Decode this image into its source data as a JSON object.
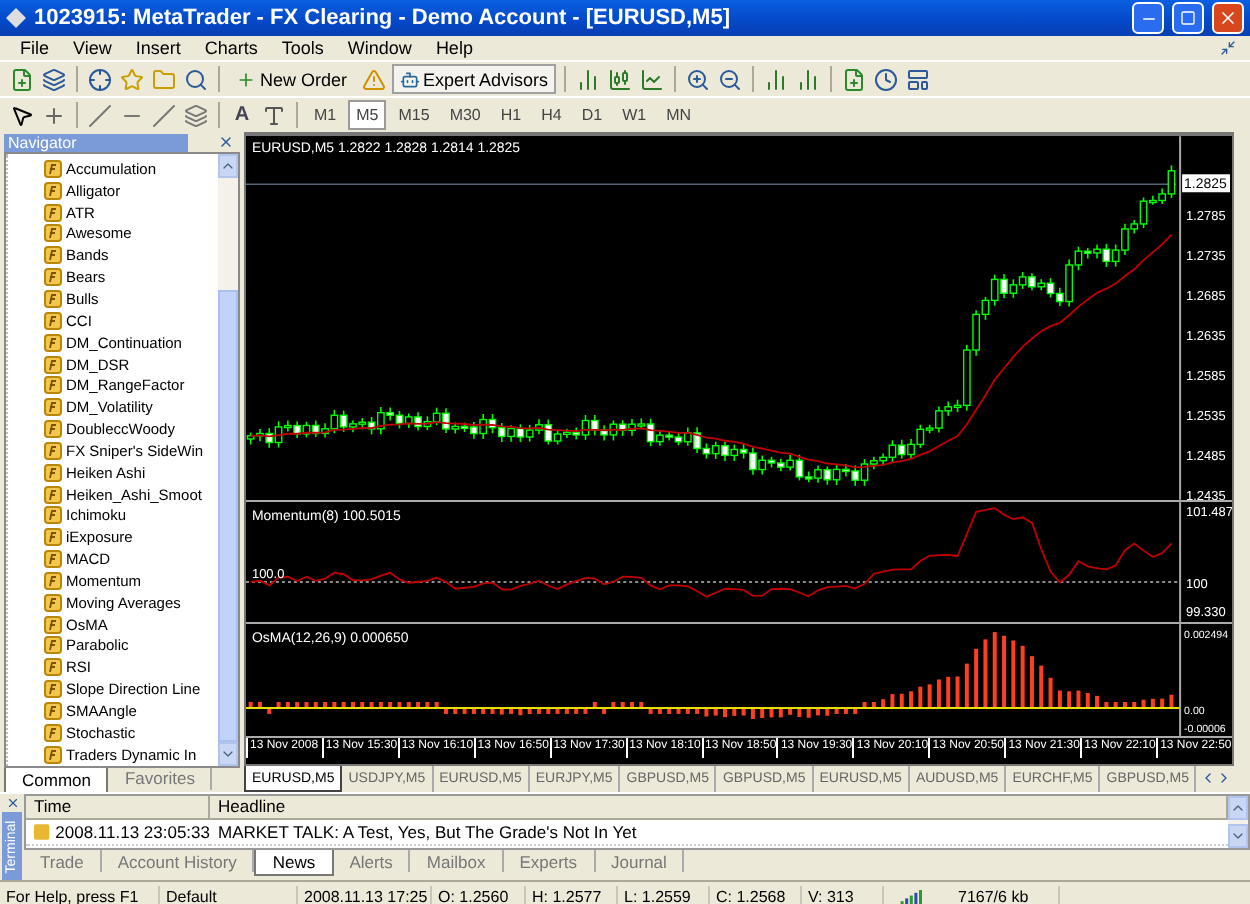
{
  "window": {
    "title": "1023915: MetaTrader - FX Clearing - Demo Account - [EURUSD,M5]"
  },
  "menu": [
    "File",
    "View",
    "Insert",
    "Charts",
    "Tools",
    "Window",
    "Help"
  ],
  "toolbar": {
    "new_order": "New Order",
    "expert_advisors": {
      "label": "Expert Advisors",
      "pressed": true
    },
    "text_tool": "A"
  },
  "timeframes": [
    {
      "label": "M1",
      "selected": false
    },
    {
      "label": "M5",
      "selected": true
    },
    {
      "label": "M15",
      "selected": false
    },
    {
      "label": "M30",
      "selected": false
    },
    {
      "label": "H1",
      "selected": false
    },
    {
      "label": "H4",
      "selected": false
    },
    {
      "label": "D1",
      "selected": false
    },
    {
      "label": "W1",
      "selected": false
    },
    {
      "label": "MN",
      "selected": false
    }
  ],
  "navigator": {
    "title": "Navigator",
    "items": [
      "Accumulation",
      "Alligator",
      "ATR",
      "Awesome",
      "Bands",
      "Bears",
      "Bulls",
      "CCI",
      "DM_Continuation",
      "DM_DSR",
      "DM_RangeFactor",
      "DM_Volatility",
      "DoubleccWoody",
      "FX Sniper's SideWin",
      "Heiken Ashi",
      "Heiken_Ashi_Smoot",
      "Ichimoku",
      "iExposure",
      "MACD",
      "Momentum",
      "Moving Averages",
      "OsMA",
      "Parabolic",
      "RSI",
      "Slope Direction Line",
      "SMAAngle",
      "Stochastic",
      "Traders Dynamic In"
    ],
    "tabs": [
      {
        "label": "Common",
        "selected": true
      },
      {
        "label": "Favorites",
        "selected": false
      }
    ]
  },
  "chart": {
    "header": "EURUSD,M5  1.2822 1.2828 1.2814 1.2825",
    "current_price": "1.2825",
    "price_labels": [
      "1.2785",
      "1.2735",
      "1.2685",
      "1.2635",
      "1.2585",
      "1.2535",
      "1.2485",
      "1.2435"
    ],
    "momentum": {
      "label": "Momentum(8) 100.5015",
      "level_label": "100.0",
      "axis": [
        "101.487",
        "100",
        "99.330"
      ]
    },
    "osma": {
      "label": "OsMA(12,26,9) 0.000650",
      "axis": [
        "0.002494",
        "0.00",
        "-0.00006"
      ]
    },
    "time_labels": [
      "13 Nov 2008",
      "13 Nov 15:30",
      "13 Nov 16:10",
      "13 Nov 16:50",
      "13 Nov 17:30",
      "13 Nov 18:10",
      "13 Nov 18:50",
      "13 Nov 19:30",
      "13 Nov 20:10",
      "13 Nov 20:50",
      "13 Nov 21:30",
      "13 Nov 22:10",
      "13 Nov 22:50"
    ]
  },
  "chart_tabs": [
    {
      "label": "EURUSD,M5",
      "selected": true
    },
    {
      "label": "USDJPY,M5",
      "selected": false
    },
    {
      "label": "EURUSD,M5",
      "selected": false
    },
    {
      "label": "EURJPY,M5",
      "selected": false
    },
    {
      "label": "GBPUSD,M5",
      "selected": false
    },
    {
      "label": "GBPUSD,M5",
      "selected": false
    },
    {
      "label": "EURUSD,M5",
      "selected": false
    },
    {
      "label": "AUDUSD,M5",
      "selected": false
    },
    {
      "label": "EURCHF,M5",
      "selected": false
    },
    {
      "label": "GBPUSD,M5",
      "selected": false
    }
  ],
  "terminal": {
    "title": "Terminal",
    "columns": [
      "Time",
      "Headline"
    ],
    "rows": [
      {
        "time": "2008.11.13 23:05:33",
        "headline": "MARKET TALK: A Test, Yes, But The Grade's Not In Yet"
      }
    ],
    "tabs": [
      {
        "label": "Trade",
        "selected": false
      },
      {
        "label": "Account History",
        "selected": false
      },
      {
        "label": "News",
        "selected": true
      },
      {
        "label": "Alerts",
        "selected": false
      },
      {
        "label": "Mailbox",
        "selected": false
      },
      {
        "label": "Experts",
        "selected": false
      },
      {
        "label": "Journal",
        "selected": false
      }
    ]
  },
  "status_bar": {
    "help": "For Help, press F1",
    "profile": "Default",
    "time": "2008.11.13 17:25",
    "open": "O: 1.2560",
    "high": "H: 1.2577",
    "low": "L: 1.2559",
    "close": "C: 1.2568",
    "volume": "V: 313",
    "traffic": "7167/6 kb"
  }
}
